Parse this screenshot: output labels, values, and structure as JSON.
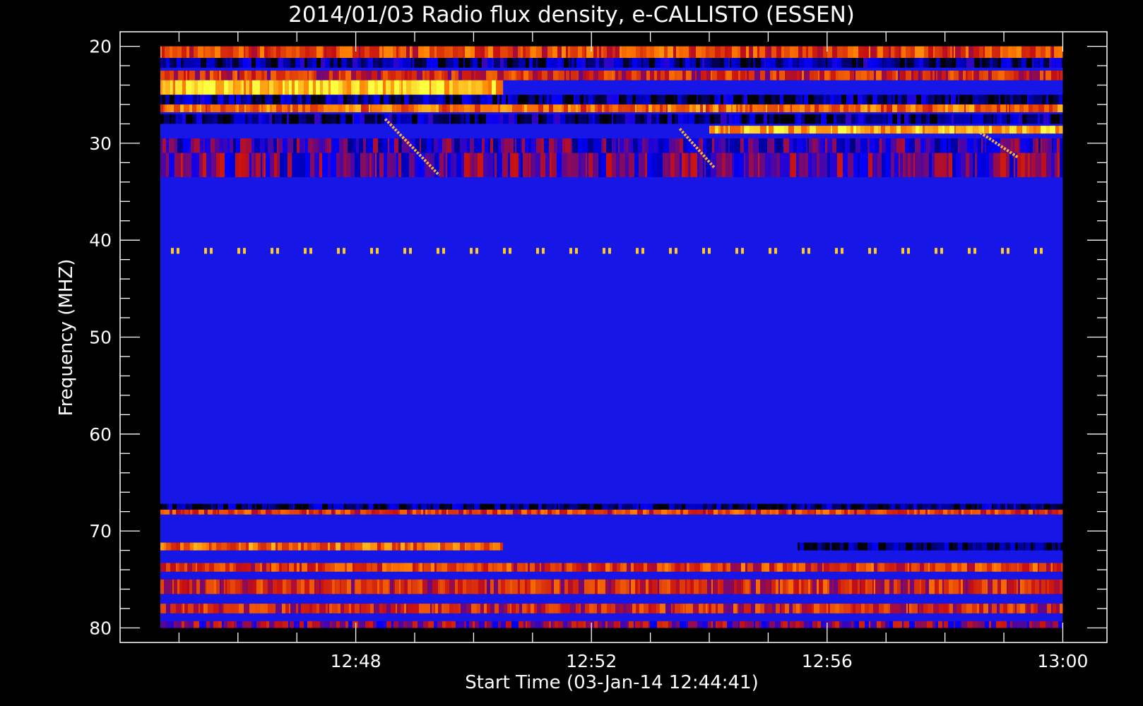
{
  "chart_data": {
    "type": "heatmap",
    "title": "2014/01/03  Radio flux density, e-CALLISTO (ESSEN)",
    "xlabel": "Start Time (03-Jan-14 12:44:41)",
    "ylabel": "Frequency (MHZ)",
    "x_start": "12:44:41",
    "xlim": [
      "12:44:00",
      "13:00:45"
    ],
    "ylim": [
      18.5,
      81.5
    ],
    "y_inverted": true,
    "data_extent": {
      "time": [
        "12:44:41",
        "13:00:00"
      ],
      "frequency_mhz": [
        20,
        80
      ]
    },
    "x_major_ticks": [
      {
        "time": "12:48",
        "label": "12:48"
      },
      {
        "time": "12:52",
        "label": "12:52"
      },
      {
        "time": "12:56",
        "label": "12:56"
      },
      {
        "time": "13:00",
        "label": "13:00"
      }
    ],
    "x_minor_ticks": [
      "12:45",
      "12:46",
      "12:47",
      "12:49",
      "12:50",
      "12:51",
      "12:53",
      "12:54",
      "12:55",
      "12:57",
      "12:58",
      "12:59"
    ],
    "y_major_ticks": [
      20,
      30,
      40,
      50,
      60,
      70,
      80
    ],
    "y_minor_step": 2,
    "colormap": [
      "#000000",
      "#0000ff",
      "#c81010",
      "#ff7a00",
      "#ffff40"
    ],
    "background_color": "#1616e6",
    "bands": [
      {
        "freq": [
          20.0,
          21.2
        ],
        "level": 0.62,
        "time": [
          "12:44:41",
          "13:00:00"
        ]
      },
      {
        "freq": [
          21.2,
          22.2
        ],
        "level": 0.15
      },
      {
        "freq": [
          22.5,
          23.5
        ],
        "level": 0.55
      },
      {
        "freq": [
          23.5,
          25.0
        ],
        "level": 0.88,
        "time": [
          "12:44:41",
          "12:50:30"
        ]
      },
      {
        "freq": [
          25.0,
          26.0
        ],
        "level": 0.12
      },
      {
        "freq": [
          26.0,
          26.8
        ],
        "level": 0.7
      },
      {
        "freq": [
          27.0,
          28.0
        ],
        "level": 0.15
      },
      {
        "freq": [
          28.2,
          29.0
        ],
        "level": 0.85,
        "time": [
          "12:54:00",
          "13:00:00"
        ]
      },
      {
        "freq": [
          29.5,
          31.0
        ],
        "level": 0.3
      },
      {
        "freq": [
          31.0,
          33.5
        ],
        "level": 0.35
      },
      {
        "freq": [
          40.8,
          41.4
        ],
        "level": 0.9,
        "pattern": "dots"
      },
      {
        "freq": [
          67.2,
          67.8
        ],
        "level": 0.1
      },
      {
        "freq": [
          67.8,
          68.3
        ],
        "level": 0.6
      },
      {
        "freq": [
          71.2,
          72.0
        ],
        "level": 0.7,
        "time": [
          "12:44:41",
          "12:50:30"
        ]
      },
      {
        "freq": [
          71.2,
          72.0
        ],
        "level": 0.08,
        "time": [
          "12:55:30",
          "13:00:00"
        ]
      },
      {
        "freq": [
          73.3,
          74.2
        ],
        "level": 0.6
      },
      {
        "freq": [
          75.0,
          76.5
        ],
        "level": 0.55
      },
      {
        "freq": [
          77.5,
          78.5
        ],
        "level": 0.55
      },
      {
        "freq": [
          79.3,
          80.0
        ],
        "level": 0.4
      }
    ],
    "drifting_bursts": [
      {
        "time": [
          "12:48:30",
          "12:49:25"
        ],
        "freq": [
          27.5,
          33.3
        ]
      },
      {
        "time": [
          "12:53:30",
          "12:54:05"
        ],
        "freq": [
          28.5,
          32.5
        ]
      },
      {
        "time": [
          "12:58:30",
          "12:59:15"
        ],
        "freq": [
          28.5,
          31.5
        ]
      }
    ]
  }
}
